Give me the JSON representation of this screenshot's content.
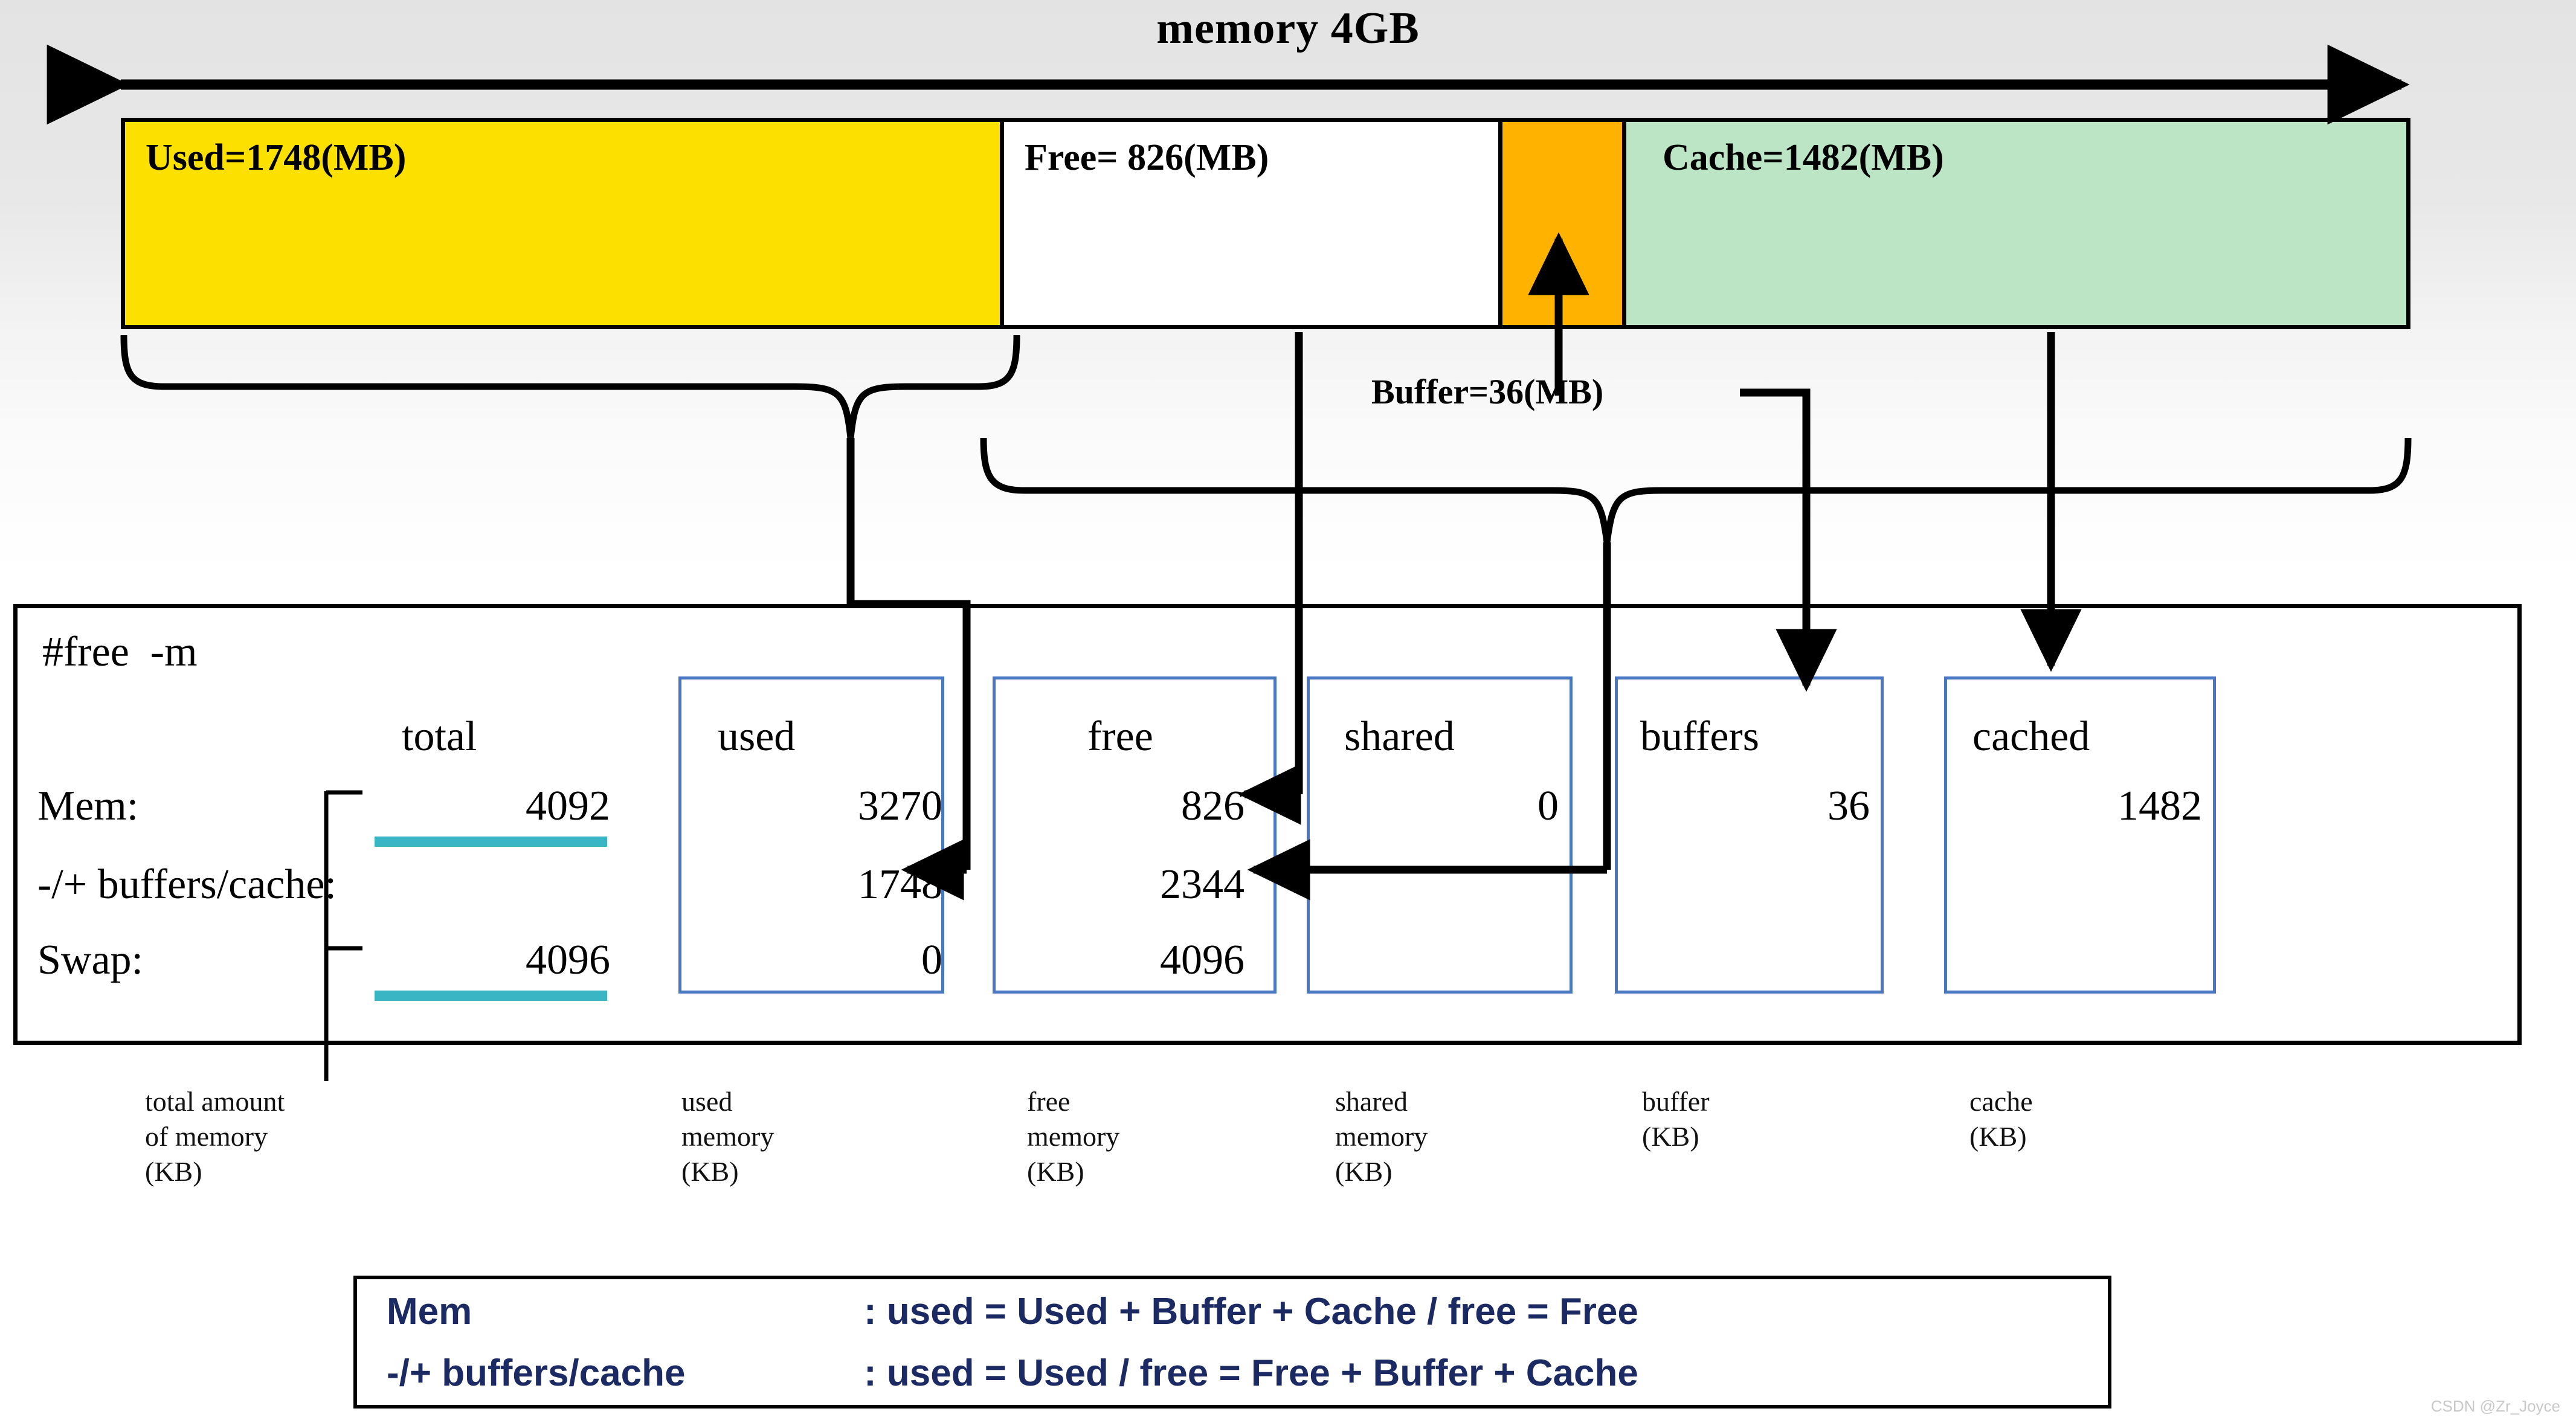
{
  "title": "memory 4GB",
  "memory_bar": {
    "segments": [
      {
        "key": "used",
        "label": "Used=1748(MB)",
        "color": "#FBE000",
        "value_mb": 1748
      },
      {
        "key": "free",
        "label": "Free= 826(MB)",
        "color": "#FFFFFF",
        "value_mb": 826
      },
      {
        "key": "buffer",
        "label": "",
        "color": "#FFB300",
        "value_mb": 36
      },
      {
        "key": "cache",
        "label": "Cache=1482(MB)",
        "color": "#BCE5C5",
        "value_mb": 1482
      }
    ],
    "buffer_callout": "Buffer=36(MB)"
  },
  "terminal": {
    "command": "#free  -m",
    "headers": [
      "total",
      "used",
      "free",
      "shared",
      "buffers",
      "cached"
    ],
    "rows": [
      {
        "label": "Mem:",
        "total": "4092",
        "used": "3270",
        "free": "826",
        "shared": "0",
        "buffers": "36",
        "cached": "1482"
      },
      {
        "label": "-/+ buffers/cache:",
        "total": "",
        "used": "1748",
        "free": "2344",
        "shared": "",
        "buffers": "",
        "cached": ""
      },
      {
        "label": "Swap:",
        "total": "4096",
        "used": "0",
        "free": "4096",
        "shared": "",
        "buffers": "",
        "cached": ""
      }
    ]
  },
  "captions": [
    {
      "key": "total",
      "text": "total amount\nof memory\n(KB)"
    },
    {
      "key": "used",
      "text": "used\nmemory\n(KB)"
    },
    {
      "key": "free",
      "text": "free\nmemory\n(KB)"
    },
    {
      "key": "shared",
      "text": "shared\nmemory\n(KB)"
    },
    {
      "key": "buffer",
      "text": "buffer\n(KB)"
    },
    {
      "key": "cache",
      "text": "cache\n(KB)"
    }
  ],
  "formula_box": {
    "line1_left": "Mem",
    "line1_right": ": used = Used + Buffer + Cache  /  free = Free",
    "line2_left": "-/+ buffers/cache",
    "line2_right": ": used = Used  /  free = Free + Buffer + Cache"
  },
  "watermark": "CSDN @Zr_Joyce",
  "colors": {
    "used_yellow": "#FBE000",
    "buffer_orange": "#FFB300",
    "cache_green": "#BCE5C5",
    "box_blue": "#4A77C4",
    "underline_teal": "#3AB5C4",
    "formula_navy": "#1B2A63"
  }
}
